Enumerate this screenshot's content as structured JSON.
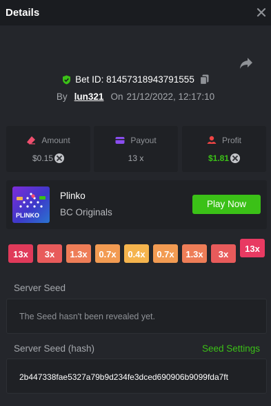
{
  "header": {
    "title": "Details"
  },
  "bet": {
    "id_label": "Bet ID: 81457318943791555",
    "by_label": "By",
    "username": "lun321",
    "on_label": "On",
    "datetime": "21/12/2022, 12:17:10"
  },
  "stats": [
    {
      "label": "Amount",
      "value": "$0.15",
      "color": "#a5a8ad"
    },
    {
      "label": "Payout",
      "value": "13 x",
      "color": "#a5a8ad"
    },
    {
      "label": "Profit",
      "value": "$1.81",
      "color": "#3bc117"
    }
  ],
  "game": {
    "name": "Plinko",
    "provider": "BC Originals",
    "play_label": "Play Now",
    "thumb_text": "PLINKO"
  },
  "multipliers": [
    {
      "label": "13x",
      "color": "#e03a5a",
      "active": false
    },
    {
      "label": "3x",
      "color": "#e85b5b",
      "active": false
    },
    {
      "label": "1.3x",
      "color": "#ee7d57",
      "active": false
    },
    {
      "label": "0.7x",
      "color": "#f29b52",
      "active": false
    },
    {
      "label": "0.4x",
      "color": "#f5b44d",
      "active": false
    },
    {
      "label": "0.7x",
      "color": "#f29b52",
      "active": false
    },
    {
      "label": "1.3x",
      "color": "#ee7d57",
      "active": false
    },
    {
      "label": "3x",
      "color": "#e85b5b",
      "active": false
    },
    {
      "label": "13x",
      "color": "#e83a62",
      "active": true
    }
  ],
  "server_seed": {
    "label": "Server Seed",
    "value": "The Seed hasn't been revealed yet."
  },
  "server_seed_hash": {
    "label": "Server Seed (hash)",
    "settings_label": "Seed Settings",
    "value": "2b447338fae5327a79b9d234fe3dced690906b9099fda7ft"
  }
}
